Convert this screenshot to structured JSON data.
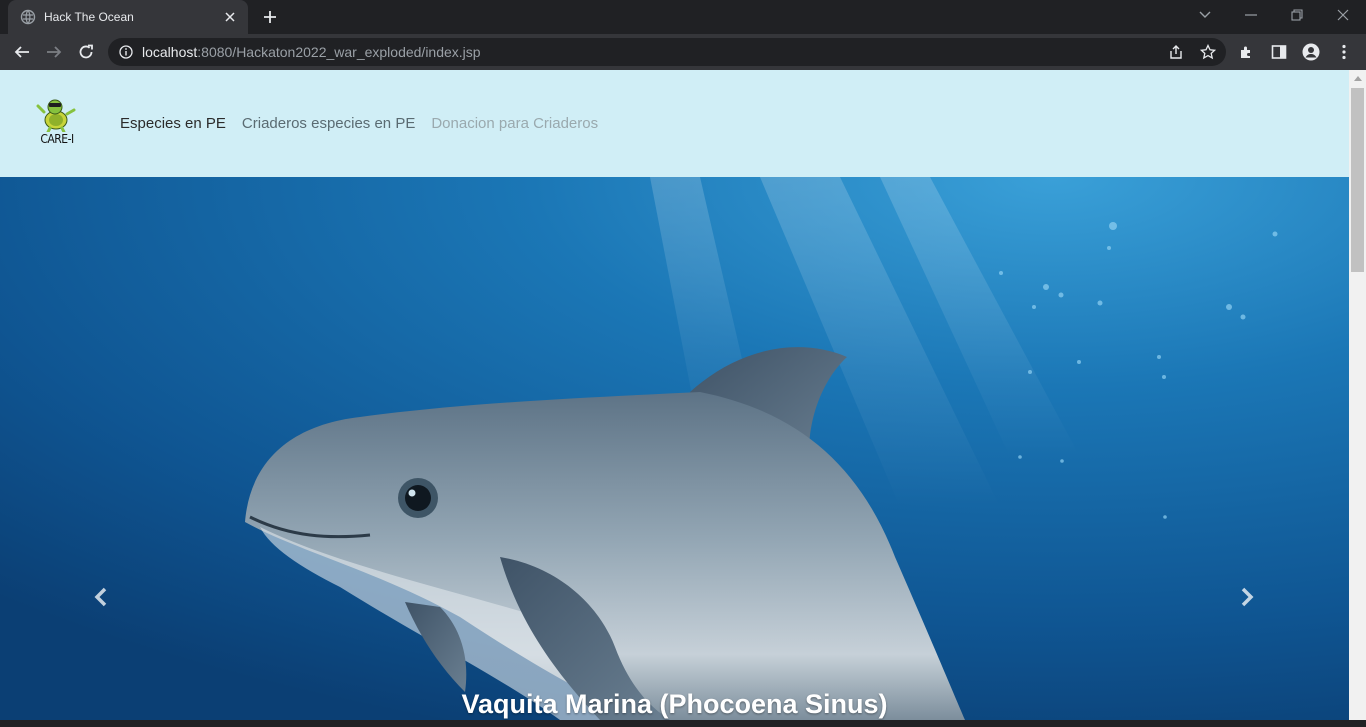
{
  "browser": {
    "tab_title": "Hack The Ocean",
    "url_host": "localhost",
    "url_rest": ":8080/Hackaton2022_war_exploded/index.jsp",
    "colors": {
      "frame": "#202124",
      "toolbar": "#35363a"
    }
  },
  "site": {
    "logo_text": "CARE-I",
    "nav": {
      "item1": "Especies en PE",
      "item2": "Criaderos especies en PE",
      "item3": "Donacion para Criaderos"
    },
    "navbar_color": "#d0eef6"
  },
  "carousel": {
    "caption": "Vaquita Marina (Phocoena Sinus)",
    "image_subject": "vaquita-porpoise-underwater",
    "prev_icon": "chevron-left-icon",
    "next_icon": "chevron-right-icon"
  }
}
